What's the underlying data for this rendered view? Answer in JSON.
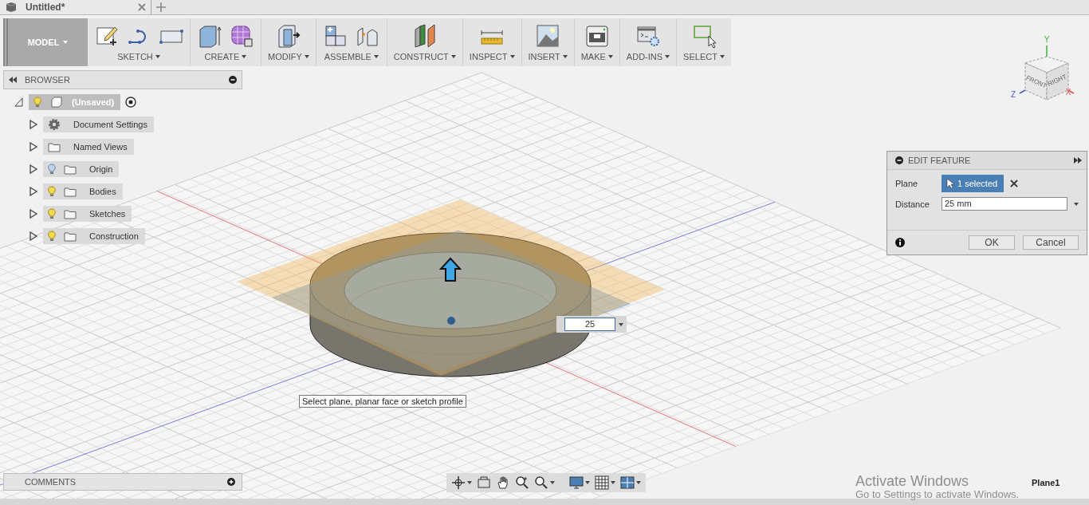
{
  "tab": {
    "title": "Untitled*"
  },
  "toolbar": {
    "mode": "MODEL",
    "groups": [
      {
        "label": "SKETCH",
        "kind": "sketch"
      },
      {
        "label": "CREATE",
        "kind": "create"
      },
      {
        "label": "MODIFY",
        "kind": "modify"
      },
      {
        "label": "ASSEMBLE",
        "kind": "assemble"
      },
      {
        "label": "CONSTRUCT",
        "kind": "construct"
      },
      {
        "label": "INSPECT",
        "kind": "inspect"
      },
      {
        "label": "INSERT",
        "kind": "insert"
      },
      {
        "label": "MAKE",
        "kind": "make"
      },
      {
        "label": "ADD-INS",
        "kind": "addins"
      },
      {
        "label": "SELECT",
        "kind": "select"
      }
    ]
  },
  "browser": {
    "title": "BROWSER",
    "root": {
      "label": "(Unsaved)",
      "expanded": true,
      "visible": true,
      "children": [
        {
          "label": "Document Settings",
          "kind": "settings",
          "expanded": false
        },
        {
          "label": "Named Views",
          "kind": "views",
          "expanded": false
        },
        {
          "label": "Origin",
          "kind": "folder",
          "expanded": false,
          "visible": false
        },
        {
          "label": "Bodies",
          "kind": "folder",
          "expanded": false,
          "visible": true
        },
        {
          "label": "Sketches",
          "kind": "folder",
          "expanded": false,
          "visible": true
        },
        {
          "label": "Construction",
          "kind": "folder",
          "expanded": false,
          "visible": true
        }
      ]
    }
  },
  "viewcube": {
    "faces": [
      "FRONT",
      "RIGHT"
    ],
    "axes": [
      "Y",
      "Z",
      "X"
    ]
  },
  "dimension_input": {
    "value": "25"
  },
  "tooltip": "Select plane, planar face or sketch profile",
  "edit_feature": {
    "title": "EDIT FEATURE",
    "fields": [
      {
        "label": "Plane",
        "kind": "selection",
        "value": "1 selected"
      },
      {
        "label": "Distance",
        "kind": "input",
        "value": "25 mm"
      }
    ],
    "buttons": [
      "OK",
      "Cancel"
    ]
  },
  "comments": {
    "title": "COMMENTS"
  },
  "status": {
    "text": "Plane1"
  },
  "activation_notice": {
    "title": "Activate Windows",
    "text": "Go to Settings to activate Windows."
  }
}
